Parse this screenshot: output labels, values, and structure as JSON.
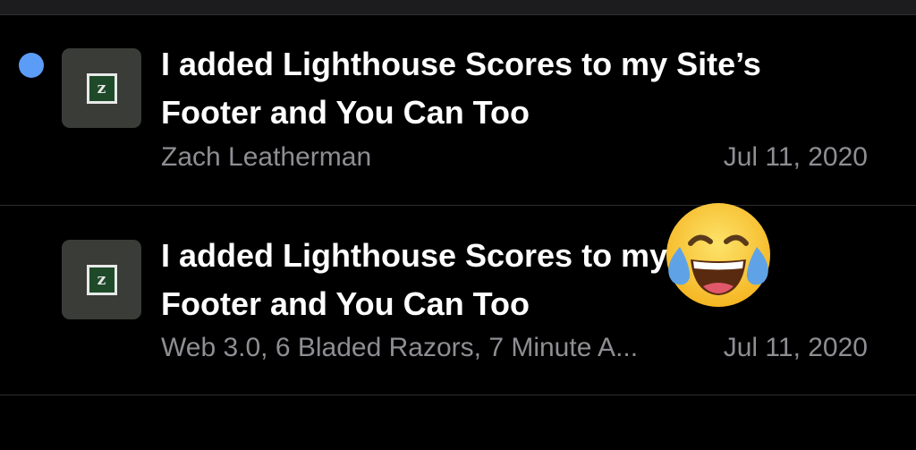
{
  "colors": {
    "background": "#000000",
    "unread_dot": "#5b9cf6",
    "secondary_text": "#8e8e93",
    "favicon_bg": "#3a3c38",
    "favicon_inner_bg": "#1f4a2a"
  },
  "feed": {
    "items": [
      {
        "unread": true,
        "icon": "zach-leatherman-favicon-icon",
        "favicon_letter": "z",
        "title_line1": "I added Lighthouse Scores to my Site’s",
        "title_line2": "Footer and You Can Too",
        "source": "Zach Leatherman",
        "date": "Jul 11, 2020"
      },
      {
        "unread": false,
        "icon": "zach-leatherman-favicon-icon",
        "favicon_letter": "z",
        "title_line1": "I added Lighthouse Scores to my Site’s",
        "title_line2": "Footer and You Can Too",
        "source": "Web 3.0, 6 Bladed Razors, 7 Minute A...",
        "date": "Jul 11, 2020"
      }
    ]
  },
  "overlay": {
    "icon": "tears-of-joy-emoji-icon"
  }
}
